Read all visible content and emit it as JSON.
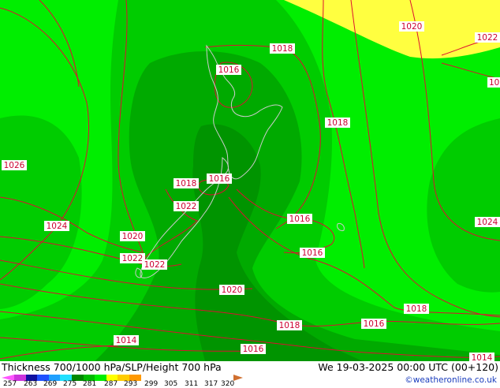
{
  "map": {
    "isobar_labels": [
      {
        "text": "1020"
      },
      {
        "text": "1022"
      },
      {
        "text": "1018"
      },
      {
        "text": "1016"
      },
      {
        "text": "1018"
      },
      {
        "text": "1026"
      },
      {
        "text": "1018"
      },
      {
        "text": "1016"
      },
      {
        "text": "1022"
      },
      {
        "text": "1016"
      },
      {
        "text": "1024"
      },
      {
        "text": "1024"
      },
      {
        "text": "1020"
      },
      {
        "text": "1022"
      },
      {
        "text": "1022"
      },
      {
        "text": "1016"
      },
      {
        "text": "1020"
      },
      {
        "text": "1018"
      },
      {
        "text": "1016"
      },
      {
        "text": "1018"
      },
      {
        "text": "1014"
      },
      {
        "text": "1016"
      },
      {
        "text": "1014"
      },
      {
        "text": "10"
      }
    ],
    "colors": {
      "bright_green": "#00ee00",
      "mid_green": "#00cc00",
      "dark_green": "#00aa00",
      "darker_green": "#009400",
      "yellow": "#ffff40",
      "isobar": "#dd1030",
      "coast": "#cccccc"
    }
  },
  "footer": {
    "title": "Thickness 700/1000 hPa/SLP/Height 700 hPa",
    "datetime": "We 19-03-2025 00:00 UTC (00+120)",
    "credit": "©weatheronline.co.uk",
    "scale_ticks": [
      "257",
      "263",
      "269",
      "275",
      "281",
      "287",
      "293",
      "299",
      "305",
      "311",
      "317",
      "320"
    ],
    "scale_colors": [
      "#ff55ff",
      "#cc33dd",
      "#1010a0",
      "#2050ff",
      "#20a0ff",
      "#20e0ff",
      "#008800",
      "#00bb00",
      "#00ee00",
      "#ffff00",
      "#ffcc00",
      "#ff9900",
      "#d07030"
    ]
  }
}
